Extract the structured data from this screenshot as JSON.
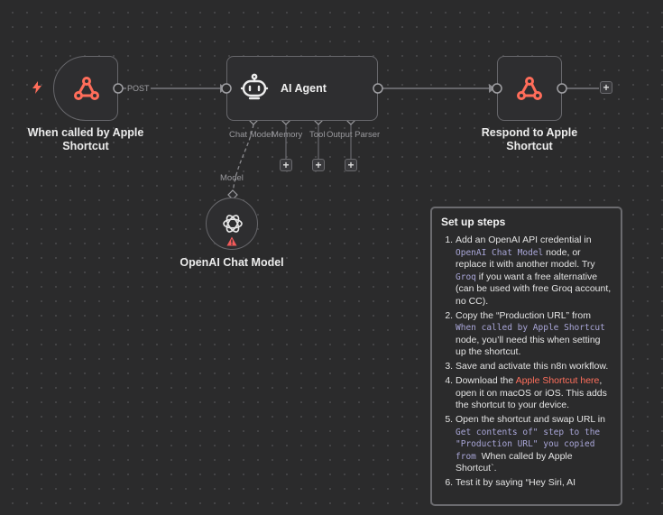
{
  "nodes": {
    "webhook": {
      "label": "When called by Apple Shortcut",
      "icon": "webhook-icon"
    },
    "agent": {
      "label": "AI Agent",
      "icon": "robot-icon",
      "ports": [
        "Chat Model",
        "Memory",
        "Tool",
        "Output Parser"
      ]
    },
    "respond": {
      "label": "Respond to Apple Shortcut",
      "icon": "webhook-icon"
    },
    "model": {
      "label": "OpenAI Chat Model",
      "connection_label": "Model",
      "icon": "openai-icon",
      "status_icon": "warning-icon"
    }
  },
  "edges": {
    "post_label": "POST"
  },
  "icons": {
    "add": "+"
  },
  "colors": {
    "accent": "#ff6d5a",
    "canvas": "#2b2b2c",
    "node_border": "#67676b",
    "code_text": "#a9a6d8",
    "warning": "#f45b5b"
  },
  "sticky": {
    "title": "Set up steps",
    "s1": {
      "a": "Add an OpenAI API credential in ",
      "b": "OpenAI Chat Model",
      "c": " node, or replace it with another model. Try ",
      "d": "Groq",
      "e": " if you want a free alternative (can be used with free Groq account, no CC)."
    },
    "s2": {
      "a": "Copy the “Production URL” from ",
      "b": "When called by Apple Shortcut",
      "c": " node, you’ll need this when setting up the shortcut."
    },
    "s3": {
      "a": "Save and activate this n8n workflow."
    },
    "s4": {
      "a": "Download the ",
      "link": "Apple Shortcut here",
      "c": ", open it on macOS or iOS. This adds the shortcut to your device."
    },
    "s5": {
      "a": "Open the shortcut and swap URL in ",
      "b": "Get contents of\" step to the \"Production URL\" you copied from ",
      "c": " When called by Apple Shortcut`."
    },
    "s6": {
      "a": "Test it by saying “Hey Siri, AI"
    }
  }
}
